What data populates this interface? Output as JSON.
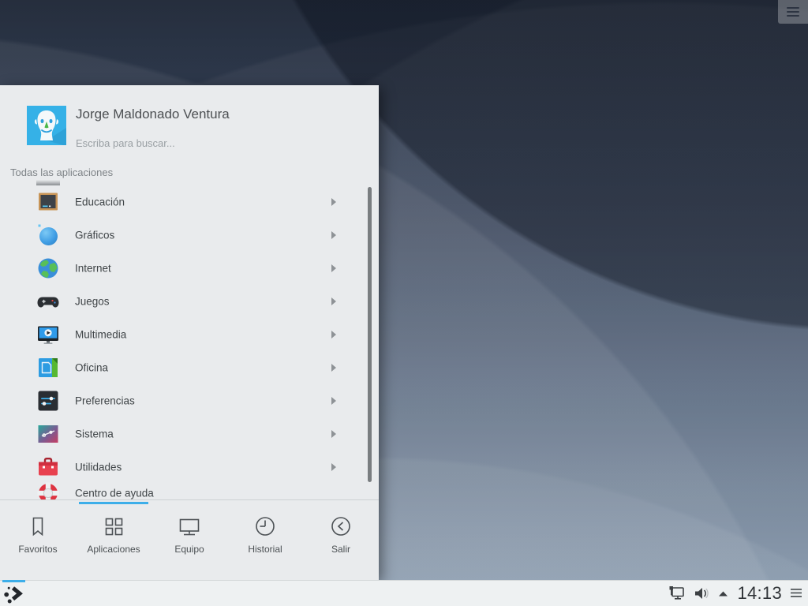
{
  "accent_color": "#3daee9",
  "desktop": {
    "toolbox_icon": "hamburger-menu-icon"
  },
  "menu": {
    "user_name": "Jorge Maldonado Ventura",
    "search_placeholder": "Escriba para buscar...",
    "section_label": "Todas las aplicaciones",
    "apps": [
      {
        "label": "Educación",
        "icon": "education-blackboard-icon"
      },
      {
        "label": "Gráficos",
        "icon": "graphics-sphere-icon"
      },
      {
        "label": "Internet",
        "icon": "internet-globe-icon"
      },
      {
        "label": "Juegos",
        "icon": "games-gamepad-icon"
      },
      {
        "label": "Multimedia",
        "icon": "multimedia-player-icon"
      },
      {
        "label": "Oficina",
        "icon": "office-document-icon"
      },
      {
        "label": "Preferencias",
        "icon": "preferences-sliders-icon"
      },
      {
        "label": "Sistema",
        "icon": "system-sliders-icon"
      },
      {
        "label": "Utilidades",
        "icon": "utilities-toolbox-icon"
      },
      {
        "label": "Centro de ayuda",
        "icon": "help-lifebuoy-icon"
      }
    ],
    "tabs": [
      {
        "label": "Favoritos",
        "icon": "bookmark-icon",
        "active": false
      },
      {
        "label": "Aplicaciones",
        "icon": "app-grid-icon",
        "active": true
      },
      {
        "label": "Equipo",
        "icon": "computer-icon",
        "active": false
      },
      {
        "label": "Historial",
        "icon": "history-clock-icon",
        "active": false
      },
      {
        "label": "Salir",
        "icon": "leave-icon",
        "active": false
      }
    ]
  },
  "taskbar": {
    "launcher_icon": "plasma-logo-icon",
    "clock": "14:13",
    "tray_icons": [
      "network-icon",
      "volume-icon",
      "expand-tray-icon",
      "panel-menu-icon"
    ]
  }
}
